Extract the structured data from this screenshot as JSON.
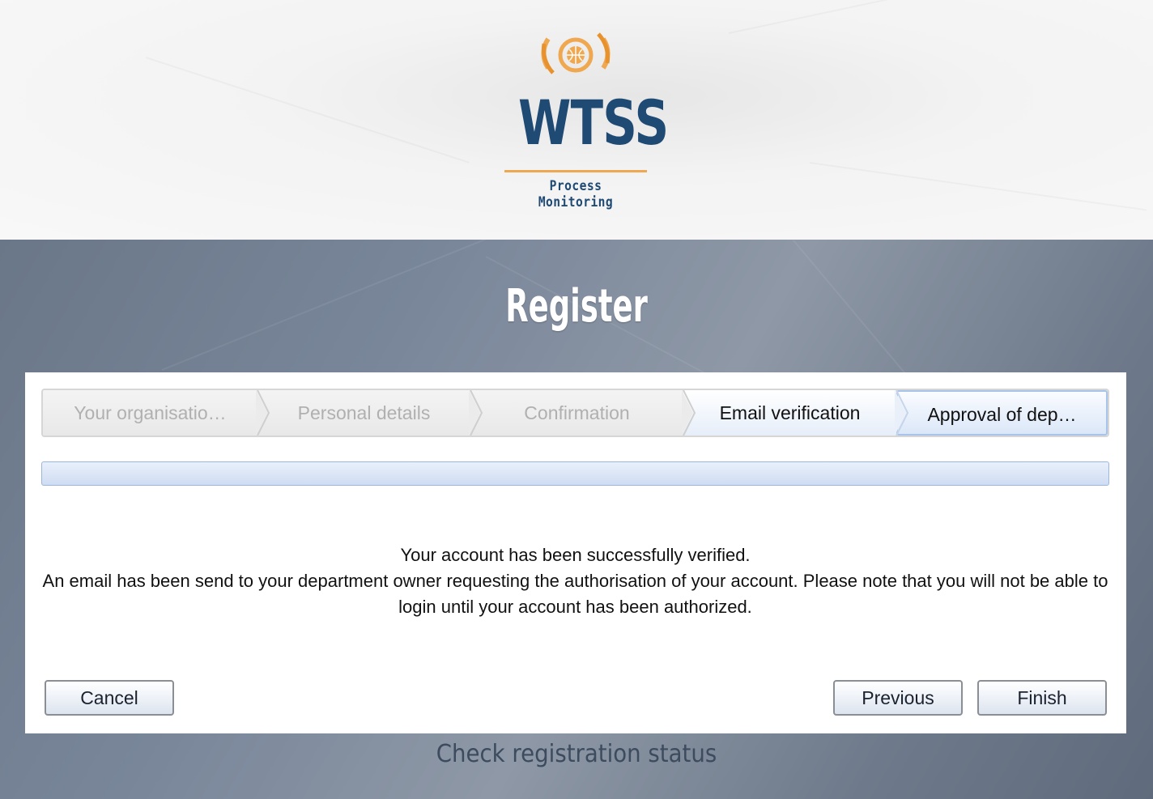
{
  "brand": {
    "name": "WTSS",
    "tagline": "Process Monitoring",
    "colors": {
      "primary": "#1f4a74",
      "accent": "#f0a850"
    }
  },
  "page": {
    "title": "Register"
  },
  "wizard": {
    "steps": [
      {
        "label": "Your organisatio…",
        "state": "completed"
      },
      {
        "label": "Personal details",
        "state": "completed"
      },
      {
        "label": "Confirmation",
        "state": "completed"
      },
      {
        "label": "Email verification",
        "state": "active"
      },
      {
        "label": "Approval of dep…",
        "state": "current"
      }
    ],
    "message": {
      "line1": "Your account has been successfully verified.",
      "line2": "An email has been send to your department owner requesting the authorisation of your account. Please note that you will not be able to login until your account has been authorized."
    },
    "buttons": {
      "cancel": "Cancel",
      "previous": "Previous",
      "finish": "Finish"
    }
  },
  "footer": {
    "status_link": "Check registration status"
  }
}
